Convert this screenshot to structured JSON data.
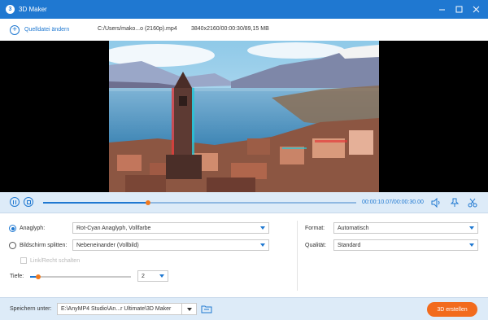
{
  "window": {
    "title": "3D Maker",
    "logo_glyph": "3",
    "controls": [
      "minimize-icon",
      "maximize-icon",
      "close-icon"
    ]
  },
  "infobar": {
    "add_source_label": "Quelldatei ändern",
    "file_path": "C:/Users/mako...o (2160p).mp4",
    "file_meta": "3840x2160/00:00:30/89,15 MB"
  },
  "player": {
    "current_time": "00:00:10.07",
    "total_time": "/00:00:30.00",
    "progress": 0.3356
  },
  "settings": {
    "anaglyph_label": "Anaglyph:",
    "anaglyph_value": "Rot-Cyan Anaglyph, Vollfarbe",
    "anaglyph_checked": true,
    "split_label": "Bildschirm splitten:",
    "split_value": "Nebeneinander (Vollbild)",
    "split_checked": false,
    "swap_label": "Link/Recht schalten",
    "swap_enabled": false,
    "depth_label": "Tiefe:",
    "depth_value": "2",
    "depth_fraction": 0.08,
    "format_label": "Format:",
    "format_value": "Automatisch",
    "quality_label": "Qualität:",
    "quality_value": "Standard"
  },
  "footer": {
    "save_label": "Speichern unter:",
    "save_path": "E:\\AnyMP4 Studio\\An...r Ultimate\\3D Maker",
    "create_button": "3D erstellen"
  },
  "colors": {
    "accent": "#1f78d1",
    "orange": "#f26b1d",
    "panel": "#ddebf8"
  }
}
